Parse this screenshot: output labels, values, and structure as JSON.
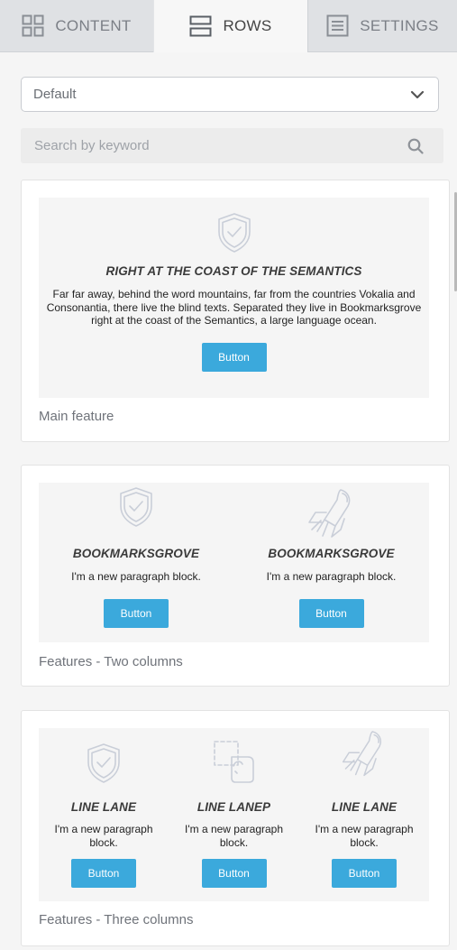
{
  "tabs": [
    {
      "label": "CONTENT",
      "icon": "grid-icon",
      "active": false
    },
    {
      "label": "ROWS",
      "icon": "rows-icon",
      "active": true
    },
    {
      "label": "SETTINGS",
      "icon": "settings-doc-icon",
      "active": false
    }
  ],
  "filter": {
    "selected": "Default"
  },
  "search": {
    "placeholder": "Search by keyword"
  },
  "colors": {
    "accent": "#3ba9dc",
    "icon_stroke": "#c9ced8"
  },
  "cards": {
    "main": {
      "label": "Main feature",
      "title": "RIGHT AT THE COAST OF THE SEMANTICS",
      "text": "Far far away, behind the word mountains, far from the countries Vokalia and Consonantia, there live the blind texts. Separated they live in Bookmarksgrove right at the coast of the Semantics, a large language ocean.",
      "button": "Button",
      "icon": "shield-check-icon"
    },
    "two": {
      "label": "Features - Two columns",
      "columns": [
        {
          "title": "BOOKMARKSGROVE",
          "text": "I'm a new paragraph block.",
          "button": "Button",
          "icon": "shield-check-icon"
        },
        {
          "title": "BOOKMARKSGROVE",
          "text": "I'm a new paragraph block.",
          "button": "Button",
          "icon": "rocket-icon"
        }
      ]
    },
    "three": {
      "label": "Features - Three columns",
      "columns": [
        {
          "title": "LINE LANE",
          "text": "I'm a new paragraph block.",
          "button": "Button",
          "icon": "shield-check-icon"
        },
        {
          "title": "LINE LANEP",
          "text": "I'm a new paragraph block.",
          "button": "Button",
          "icon": "drag-hand-icon"
        },
        {
          "title": "LINE LANE",
          "text": "I'm a new paragraph block.",
          "button": "Button",
          "icon": "rocket-icon"
        }
      ]
    }
  }
}
